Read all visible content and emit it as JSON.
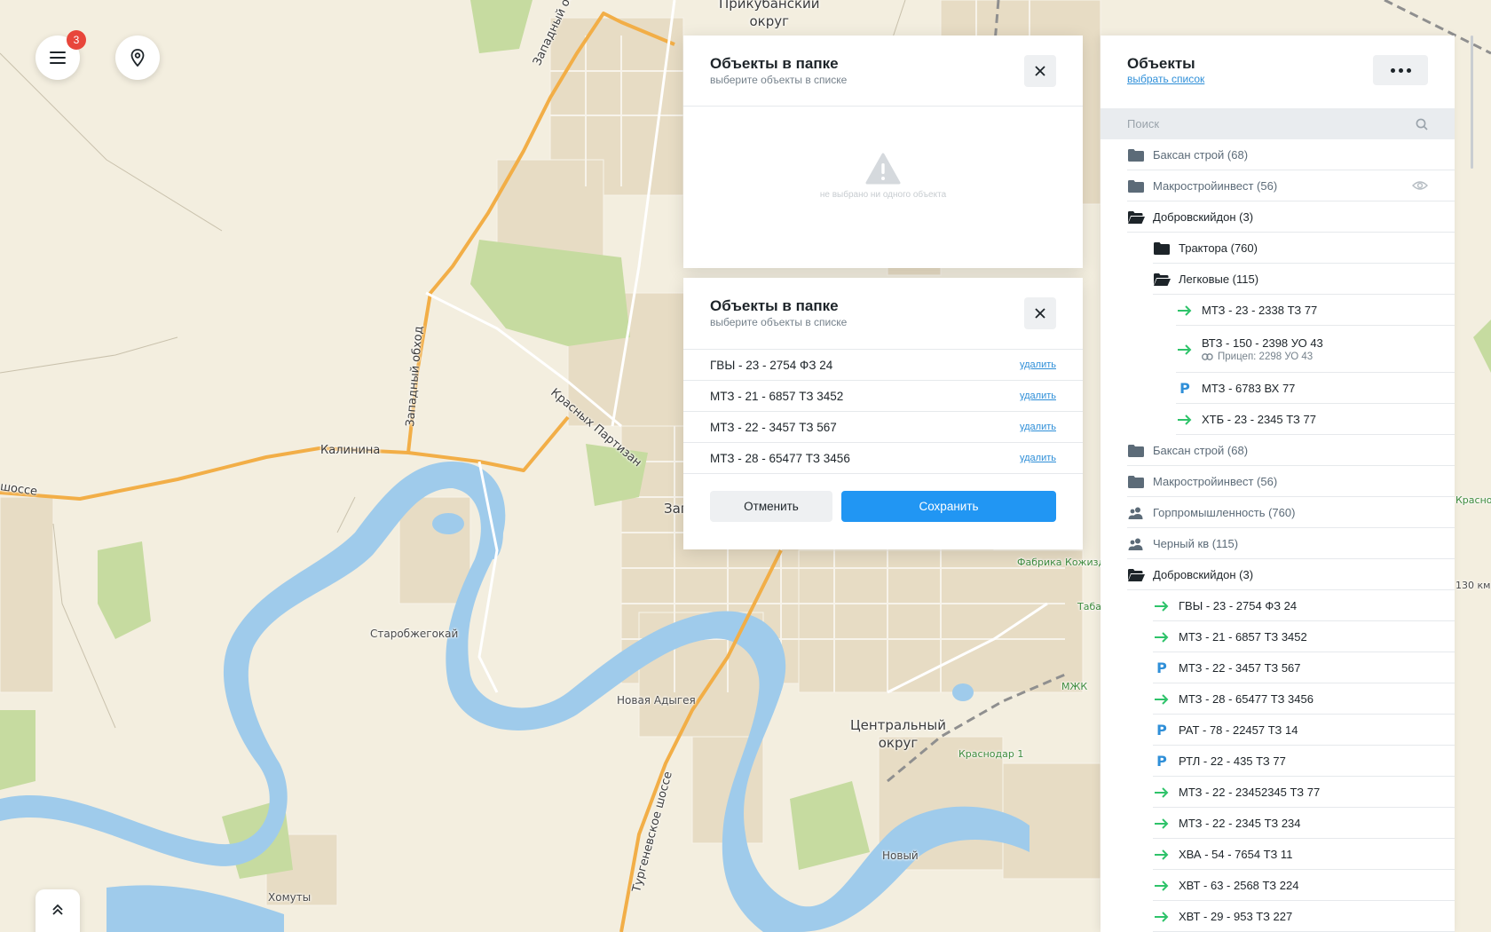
{
  "map": {
    "labels": {
      "okrug_top": "Прикубанский\nокруг",
      "zapadny_obhod_1": "Западный обход",
      "zapadny_obhod_2": "Западный обход",
      "kalinina": "Калинина",
      "shosse": "шоссе",
      "krasnyh_partizan": "Красных Партизан",
      "starobzhegokay": "Старобжегокай",
      "novaya_adygeya": "Новая Адыгея",
      "tsentralny": "Центральный\nокруг",
      "krasnodar1": "Краснодар 1",
      "mzhk": "МЖК",
      "fabrika": "Фабрика Кожизд",
      "taba": "Таба",
      "novy": "Новый",
      "homuty": "Хомуты",
      "turgenevskoe": "Тургеневское шоссе",
      "zap_cut": "Зап",
      "krasnod_cut": "Краснод",
      "km130": "130 км"
    }
  },
  "menu": {
    "badge": "3"
  },
  "modal_empty": {
    "title": "Объекты в папке",
    "subtitle": "выберите объекты в списке",
    "empty_text": "не выбрано ни одного объекта"
  },
  "modal_selected": {
    "title": "Объекты в папке",
    "subtitle": "выберите объекты в списке",
    "delete_label": "удалить",
    "items": [
      "ГВЫ - 23 - 2754 ФЗ 24",
      "МТЗ - 21 - 6857 ТЗ 3452",
      "МТЗ - 22 - 3457 ТЗ 567",
      "МТЗ - 28 - 65477 ТЗ 3456"
    ],
    "cancel": "Отменить",
    "save": "Сохранить"
  },
  "panel": {
    "title": "Объекты",
    "choose_list": "выбрать список",
    "search_placeholder": "Поиск",
    "tree": [
      {
        "type": "folder",
        "level": 0,
        "label": "Баксан строй (68)",
        "muted": true
      },
      {
        "type": "folder",
        "level": 0,
        "label": "Макростройинвест (56)",
        "muted": true,
        "eye": true
      },
      {
        "type": "folder-open",
        "level": 0,
        "label": "Добровскийдон (3)"
      },
      {
        "type": "folder-dark",
        "level": 1,
        "label": "Трактора (760)"
      },
      {
        "type": "folder-open",
        "level": 1,
        "label": "Легковые (115)"
      },
      {
        "type": "arrow",
        "level": 2,
        "label": "МТЗ - 23 - 2338 ТЗ 77"
      },
      {
        "type": "arrow",
        "level": 2,
        "label": "ВТЗ - 150 - 2398 УО 43",
        "sub": "Прицеп: 2298 УО 43"
      },
      {
        "type": "parking",
        "level": 2,
        "label": "МТЗ - 6783 ВХ 77"
      },
      {
        "type": "arrow",
        "level": 2,
        "label": "ХТБ - 23 - 2345 ТЗ 77"
      },
      {
        "type": "folder",
        "level": 0,
        "label": "Баксан строй (68)",
        "muted": true
      },
      {
        "type": "folder",
        "level": 0,
        "label": "Макростройинвест (56)",
        "muted": true
      },
      {
        "type": "users",
        "level": 0,
        "label": "Горпромышленность (760)",
        "muted": true
      },
      {
        "type": "users",
        "level": 0,
        "label": "Черный кв (115)",
        "muted": true
      },
      {
        "type": "folder-open",
        "level": 0,
        "label": "Добровскийдон (3)"
      },
      {
        "type": "arrow",
        "level": 1,
        "label": "ГВЫ - 23 - 2754 ФЗ 24"
      },
      {
        "type": "arrow",
        "level": 1,
        "label": "МТЗ - 21 - 6857 ТЗ 3452"
      },
      {
        "type": "parking",
        "level": 1,
        "label": "МТЗ - 22 - 3457 ТЗ 567"
      },
      {
        "type": "arrow",
        "level": 1,
        "label": "МТЗ - 28 - 65477 ТЗ 3456"
      },
      {
        "type": "parking",
        "level": 1,
        "label": "РАТ - 78 - 22457 ТЗ 14"
      },
      {
        "type": "parking",
        "level": 1,
        "label": "РТЛ - 22 - 435 ТЗ 77"
      },
      {
        "type": "arrow",
        "level": 1,
        "label": "МТЗ - 22 - 23452345 ТЗ 77"
      },
      {
        "type": "arrow",
        "level": 1,
        "label": "МТЗ - 22 - 2345 ТЗ 234"
      },
      {
        "type": "arrow",
        "level": 1,
        "label": "ХВА - 54 - 7654 ТЗ 11"
      },
      {
        "type": "arrow",
        "level": 1,
        "label": "ХВТ - 63 - 2568 ТЗ 224"
      },
      {
        "type": "arrow",
        "level": 1,
        "label": "ХВТ - 29 - 953 ТЗ 227"
      }
    ]
  },
  "colors": {
    "accent": "#2196f3",
    "link": "#2f8fd8",
    "moving": "#2ec36a",
    "badge": "#e8463b",
    "folder": "#5c6b78"
  }
}
